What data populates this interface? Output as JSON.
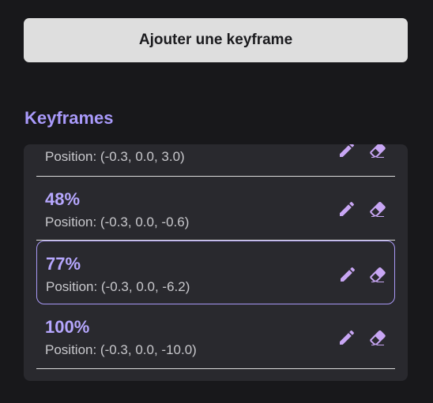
{
  "toolbar": {
    "add_keyframe_label": "Ajouter une keyframe"
  },
  "section": {
    "title": "Keyframes"
  },
  "icons": {
    "edit": "pencil-icon",
    "delete": "eraser-icon"
  },
  "colors": {
    "accent": "#a99afb",
    "background": "#18181b",
    "panel": "#29292e",
    "button": "#dedede"
  },
  "keyframes": [
    {
      "percent": "",
      "position": "Position: (-0.3, 0.0, 3.0)",
      "selected": false
    },
    {
      "percent": "48%",
      "position": "Position: (-0.3, 0.0, -0.6)",
      "selected": false
    },
    {
      "percent": "77%",
      "position": "Position: (-0.3, 0.0, -6.2)",
      "selected": true
    },
    {
      "percent": "100%",
      "position": "Position: (-0.3, 0.0, -10.0)",
      "selected": false
    }
  ]
}
